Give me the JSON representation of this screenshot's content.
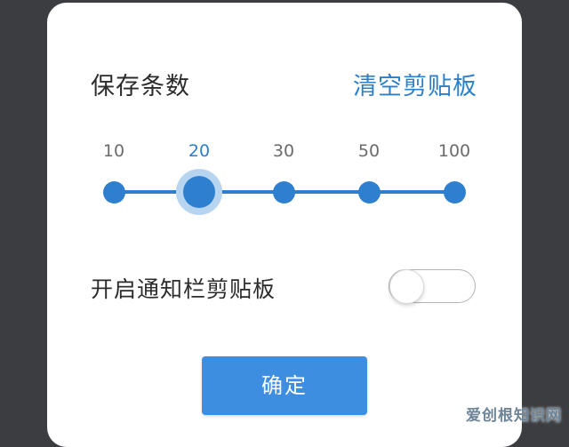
{
  "dialog": {
    "title": "保存条数",
    "clear_button_label": "清空剪贴板",
    "slider": {
      "stops": [
        "10",
        "20",
        "30",
        "50",
        "100"
      ],
      "selected_value": "20",
      "selected_index": 1
    },
    "notification_switch": {
      "label": "开启通知栏剪贴板",
      "state": "off"
    },
    "confirm_button_label": "确定"
  },
  "watermark": "爱创根知识网",
  "colors": {
    "accent": "#2f7fd0",
    "button": "#3d8de0",
    "halo": "#b7d4f1",
    "backdrop": "#3b3d41"
  }
}
